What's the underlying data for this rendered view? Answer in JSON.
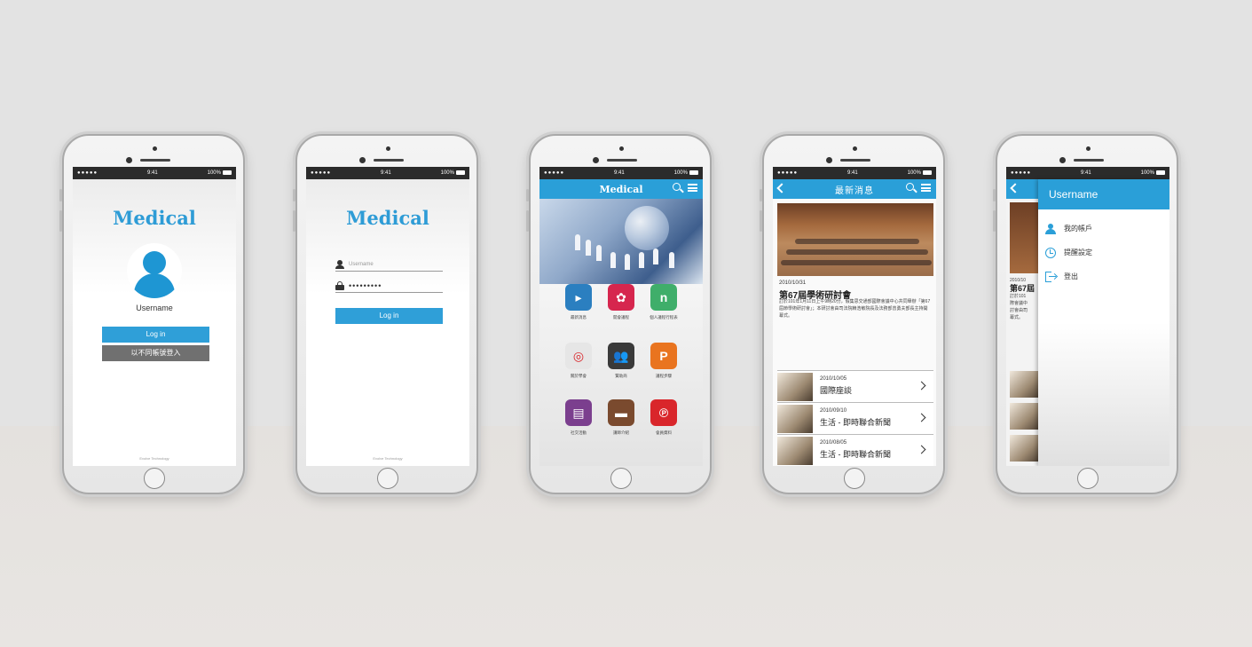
{
  "status": {
    "signal": "●●●●● ",
    "time": "9:41",
    "battery": "100%"
  },
  "screen1": {
    "brand": "Medical",
    "username": "Username",
    "login_button": "Log in",
    "alt_login_button": "以不同帳號登入",
    "footer": "Evolve Technology"
  },
  "screen2": {
    "brand": "Medical",
    "username_placeholder": "Username",
    "password_value": "•••••••••",
    "login_button": "Log in",
    "footer": "Evolve Technology"
  },
  "screen3": {
    "title": "Medical",
    "tiles": [
      {
        "label": "最新消息",
        "icon": "play-icon",
        "color": "#2b7fc0",
        "glyph": "▸"
      },
      {
        "label": "開會議程",
        "icon": "flower-icon",
        "color": "#d6264e",
        "glyph": "✿"
      },
      {
        "label": "個人議程行程表",
        "icon": "n-icon",
        "color": "#3fae6a",
        "glyph": "n"
      },
      {
        "label": "關於學會",
        "icon": "lifebuoy-icon",
        "color": "#e6e6e6",
        "glyph": "◎"
      },
      {
        "label": "贊助商",
        "icon": "people-icon",
        "color": "#3a3a3a",
        "glyph": "👥"
      },
      {
        "label": "議程步驟",
        "icon": "p-icon",
        "color": "#e9741f",
        "glyph": "P"
      },
      {
        "label": "社交活動",
        "icon": "book-icon",
        "color": "#7b3f8e",
        "glyph": "▤"
      },
      {
        "label": "講師介紹",
        "icon": "notebook-icon",
        "color": "#7a4a2e",
        "glyph": "▬"
      },
      {
        "label": "會員資料",
        "icon": "pinterest-icon",
        "color": "#d9262b",
        "glyph": "℗"
      }
    ]
  },
  "screen4": {
    "title": "最新消息",
    "main": {
      "date": "2010/10/31",
      "headline": "第67屆學術研討會",
      "body": "訂於101年1月11日上午9時20分，假集思交通部國際會議中心共同舉辦「第67屆節學術研討會」；本研討會由司法院賴浩敏院長及法務部曾勇夫部長主持開幕式。"
    },
    "items": [
      {
        "date": "2010/10/05",
        "title": "國際座談"
      },
      {
        "date": "2010/09/10",
        "title": "生活 - 即時聯合新聞"
      },
      {
        "date": "2010/08/05",
        "title": "生活 - 即時聯合新聞"
      }
    ]
  },
  "screen5": {
    "drawer_title": "Username",
    "menu": [
      {
        "label": "我的帳戶",
        "icon": "user-icon"
      },
      {
        "label": "提醒設定",
        "icon": "alarm-icon"
      },
      {
        "label": "登出",
        "icon": "logout-icon"
      }
    ],
    "under_date": "2010/10",
    "under_title": "第67屆",
    "under_lines": [
      "訂於101",
      "際會議中",
      "討會由司",
      "幕式。"
    ]
  }
}
